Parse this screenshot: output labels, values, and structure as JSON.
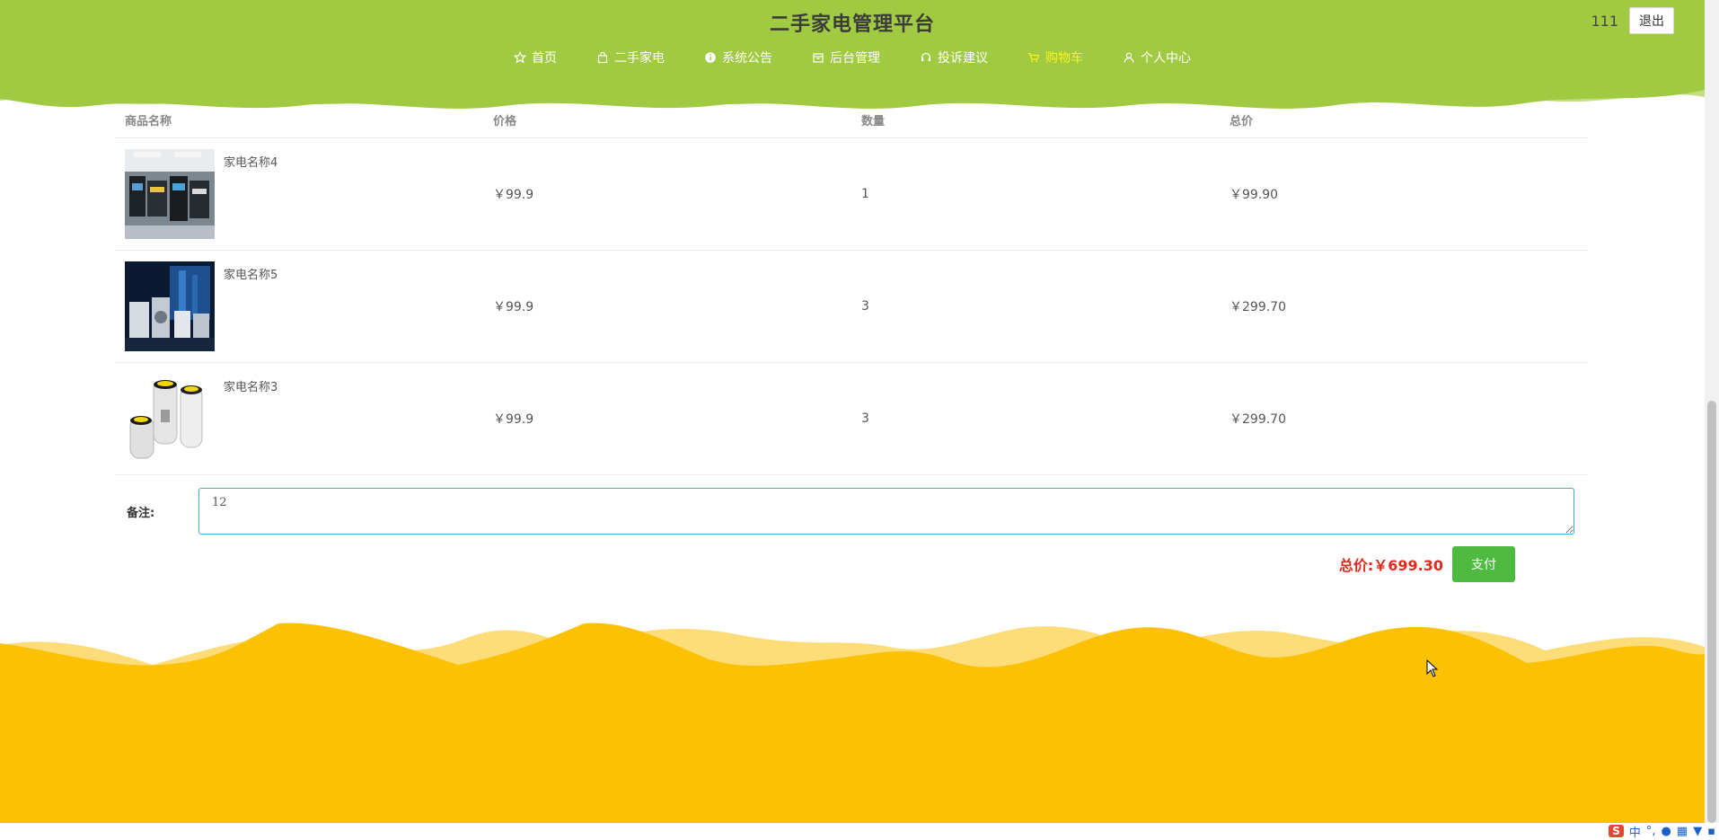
{
  "header": {
    "title": "二手家电管理平台",
    "username": "111",
    "logout_label": "退出",
    "bg_color": "#a0ca41",
    "nav": [
      {
        "label": "首页",
        "icon": "star-icon"
      },
      {
        "label": "二手家电",
        "icon": "bag-icon"
      },
      {
        "label": "系统公告",
        "icon": "info-icon"
      },
      {
        "label": "后台管理",
        "icon": "folder-icon"
      },
      {
        "label": "投诉建议",
        "icon": "headset-icon"
      },
      {
        "label": "购物车",
        "icon": "cart-icon",
        "active": true
      },
      {
        "label": "个人中心",
        "icon": "user-icon"
      }
    ]
  },
  "cart": {
    "columns": [
      "商品名称",
      "价格",
      "数量",
      "总价"
    ],
    "rows": [
      {
        "name": "家电名称4",
        "price": "￥99.9",
        "qty": "1",
        "subtotal": "￥99.90"
      },
      {
        "name": "家电名称5",
        "price": "￥99.9",
        "qty": "3",
        "subtotal": "￥299.70"
      },
      {
        "name": "家电名称3",
        "price": "￥99.9",
        "qty": "3",
        "subtotal": "￥299.70"
      }
    ],
    "remark_label": "备注:",
    "remark_value": "12",
    "total_label": "总价:￥699.30",
    "pay_label": "支付"
  },
  "colors": {
    "accent_green": "#4fba40",
    "footer_yellow": "#fdc104",
    "total_red": "#e0291f"
  },
  "tray": {
    "ime_label": "S",
    "lang": "中"
  }
}
